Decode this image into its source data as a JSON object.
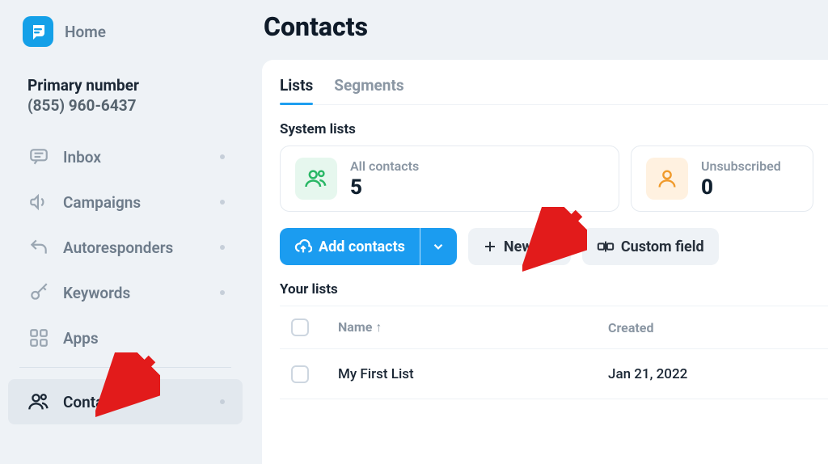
{
  "sidebar": {
    "home_label": "Home",
    "primary_title": "Primary number",
    "primary_number": "(855) 960-6437",
    "items": [
      {
        "label": "Inbox",
        "has_dot": true
      },
      {
        "label": "Campaigns",
        "has_dot": true
      },
      {
        "label": "Autoresponders",
        "has_dot": true
      },
      {
        "label": "Keywords",
        "has_dot": true
      },
      {
        "label": "Apps",
        "has_dot": false
      }
    ],
    "active_item": {
      "label": "Contacts",
      "has_dot": true
    }
  },
  "main": {
    "page_title": "Contacts",
    "tabs": [
      {
        "label": "Lists",
        "active": true
      },
      {
        "label": "Segments",
        "active": false
      }
    ],
    "system_lists_label": "System lists",
    "cards": {
      "all_contacts": {
        "label": "All contacts",
        "count": "5"
      },
      "unsubscribed": {
        "label": "Unsubscribed",
        "count": "0"
      }
    },
    "actions": {
      "add_contacts": "Add contacts",
      "new_list": "New list",
      "custom_field": "Custom field"
    },
    "your_lists_label": "Your lists",
    "table": {
      "columns": {
        "name": "Name",
        "created": "Created"
      },
      "sort_arrow": "↑",
      "rows": [
        {
          "name": "My First List",
          "created": "Jan 21, 2022"
        }
      ]
    }
  },
  "colors": {
    "accent": "#1b9cf0",
    "green": "#29b765",
    "orange": "#f09a2b"
  }
}
